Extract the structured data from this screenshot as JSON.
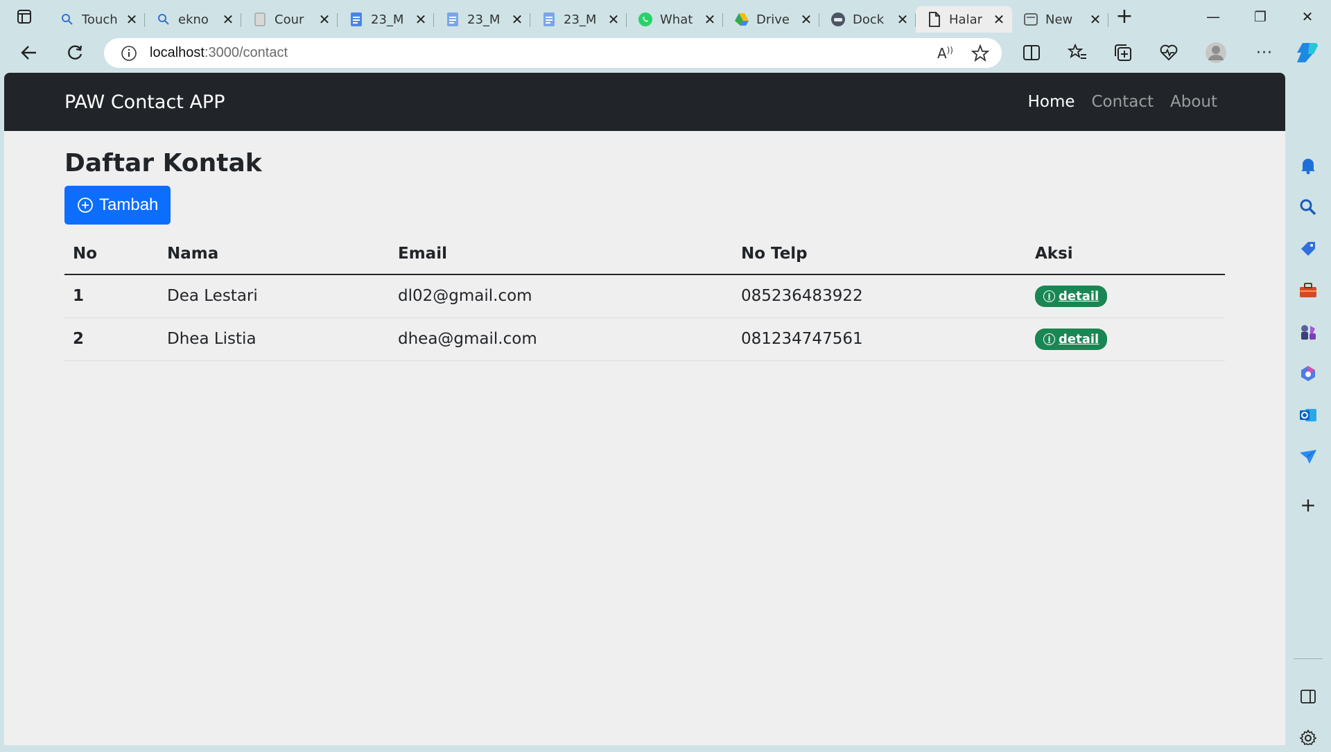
{
  "browser": {
    "tabs": [
      {
        "title": "Touch",
        "icon": "search-icon",
        "active": false
      },
      {
        "title": "ekno",
        "icon": "search-icon",
        "active": false
      },
      {
        "title": "Cour",
        "icon": "page-icon",
        "active": false
      },
      {
        "title": "23_M",
        "icon": "docs-icon",
        "active": false
      },
      {
        "title": "23_M",
        "icon": "docs-icon",
        "active": false
      },
      {
        "title": "23_M",
        "icon": "docs-icon",
        "active": false
      },
      {
        "title": "What",
        "icon": "whatsapp-icon",
        "active": false
      },
      {
        "title": "Drive",
        "icon": "drive-icon",
        "active": false
      },
      {
        "title": "Dock",
        "icon": "docker-icon",
        "active": false
      },
      {
        "title": "Halar",
        "icon": "file-icon",
        "active": true
      },
      {
        "title": "New",
        "icon": "newtab-icon",
        "active": false
      }
    ],
    "address": {
      "host": "localhost",
      "rest": ":3000/contact"
    }
  },
  "app": {
    "brand": "PAW Contact APP",
    "nav": {
      "home": "Home",
      "contact": "Contact",
      "about": "About"
    },
    "page_title": "Daftar Kontak",
    "add_button": "Tambah",
    "table": {
      "headers": {
        "no": "No",
        "nama": "Nama",
        "email": "Email",
        "telp": "No Telp",
        "aksi": "Aksi"
      },
      "rows": [
        {
          "no": "1",
          "nama": "Dea Lestari",
          "email": "dl02@gmail.com",
          "telp": "085236483922",
          "action": "detail"
        },
        {
          "no": "2",
          "nama": "Dhea Listia",
          "email": "dhea@gmail.com",
          "telp": "081234747561",
          "action": "detail"
        }
      ]
    }
  },
  "colors": {
    "navbar": "#212529",
    "primary": "#0d6efd",
    "success": "#198754",
    "chrome": "#cfe3e6",
    "page_bg": "#f0efef"
  }
}
